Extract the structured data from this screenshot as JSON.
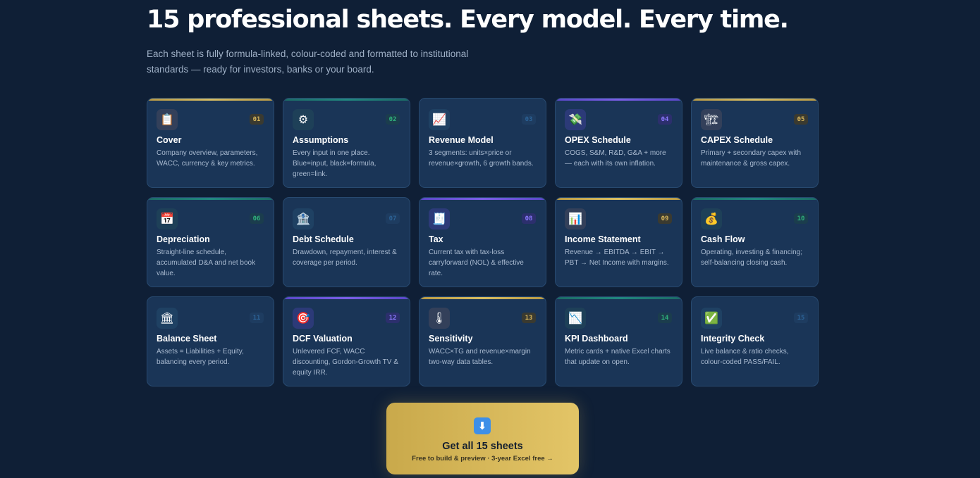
{
  "header": {
    "headline": "15 professional sheets. Every model. Every time.",
    "subtitle": "Each sheet is fully formula-linked, colour-coded and formatted to institutional standards — ready for investors, banks or your board."
  },
  "sheets": [
    {
      "num": "01",
      "icon": "📋",
      "icon_name": "clipboard-icon",
      "title": "Cover",
      "desc": "Company overview, parameters, WACC, currency & key metrics.",
      "accent": "gold"
    },
    {
      "num": "02",
      "icon": "⚙",
      "icon_name": "gear-icon",
      "title": "Assumptions",
      "desc": "Every input in one place. Blue=input, black=formula, green=link.",
      "accent": "teal"
    },
    {
      "num": "03",
      "icon": "📈",
      "icon_name": "chart-increasing-icon",
      "title": "Revenue Model",
      "desc": "3 segments: units×price or revenue×growth, 6 growth bands.",
      "accent": "blue"
    },
    {
      "num": "04",
      "icon": "💸",
      "icon_name": "money-with-wings-icon",
      "title": "OPEX Schedule",
      "desc": "COGS, S&M, R&D, G&A + more — each with its own inflation.",
      "accent": "purple"
    },
    {
      "num": "05",
      "icon": "🏗",
      "icon_name": "construction-crane-icon",
      "title": "CAPEX Schedule",
      "desc": "Primary + secondary capex with maintenance & gross capex.",
      "accent": "gold"
    },
    {
      "num": "06",
      "icon": "📅",
      "icon_name": "calendar-icon",
      "title": "Depreciation",
      "desc": "Straight-line schedule, accumulated D&A and net book value.",
      "accent": "teal"
    },
    {
      "num": "07",
      "icon": "🏦",
      "icon_name": "bank-icon",
      "title": "Debt Schedule",
      "desc": "Drawdown, repayment, interest & coverage per period.",
      "accent": "blue"
    },
    {
      "num": "08",
      "icon": "🧾",
      "icon_name": "receipt-icon",
      "title": "Tax",
      "desc": "Current tax with tax-loss carryforward (NOL) & effective rate.",
      "accent": "purple"
    },
    {
      "num": "09",
      "icon": "📊",
      "icon_name": "bar-chart-icon",
      "title": "Income Statement",
      "desc": "Revenue → EBITDA → EBIT → PBT → Net Income with margins.",
      "accent": "gold"
    },
    {
      "num": "10",
      "icon": "💰",
      "icon_name": "money-bag-icon",
      "title": "Cash Flow",
      "desc": "Operating, investing & financing; self-balancing closing cash.",
      "accent": "teal"
    },
    {
      "num": "11",
      "icon": "🏛",
      "icon_name": "classical-building-icon",
      "title": "Balance Sheet",
      "desc": "Assets = Liabilities + Equity, balancing every period.",
      "accent": "blue"
    },
    {
      "num": "12",
      "icon": "🎯",
      "icon_name": "target-icon",
      "title": "DCF Valuation",
      "desc": "Unlevered FCF, WACC discounting, Gordon-Growth TV & equity IRR.",
      "accent": "purple"
    },
    {
      "num": "13",
      "icon": "🌡",
      "icon_name": "thermometer-icon",
      "title": "Sensitivity",
      "desc": "WACC×TG and revenue×margin two-way data tables.",
      "accent": "gold"
    },
    {
      "num": "14",
      "icon": "📉",
      "icon_name": "chart-decreasing-icon",
      "title": "KPI Dashboard",
      "desc": "Metric cards + native Excel charts that update on open.",
      "accent": "teal"
    },
    {
      "num": "15",
      "icon": "✅",
      "icon_name": "check-mark-icon",
      "title": "Integrity Check",
      "desc": "Live balance & ratio checks, colour-coded PASS/FAIL.",
      "accent": "blue"
    }
  ],
  "cta": {
    "icon": "⬇",
    "title": "Get all 15 sheets",
    "subtitle": "Free to build & preview · 3-year Excel free →"
  },
  "colors": {
    "background": "#0f1f36",
    "card": "#1a3557",
    "gold": "#d8bd62",
    "teal": "#21877f",
    "purple": "#7b5ee6",
    "cta": "#e3c567"
  }
}
